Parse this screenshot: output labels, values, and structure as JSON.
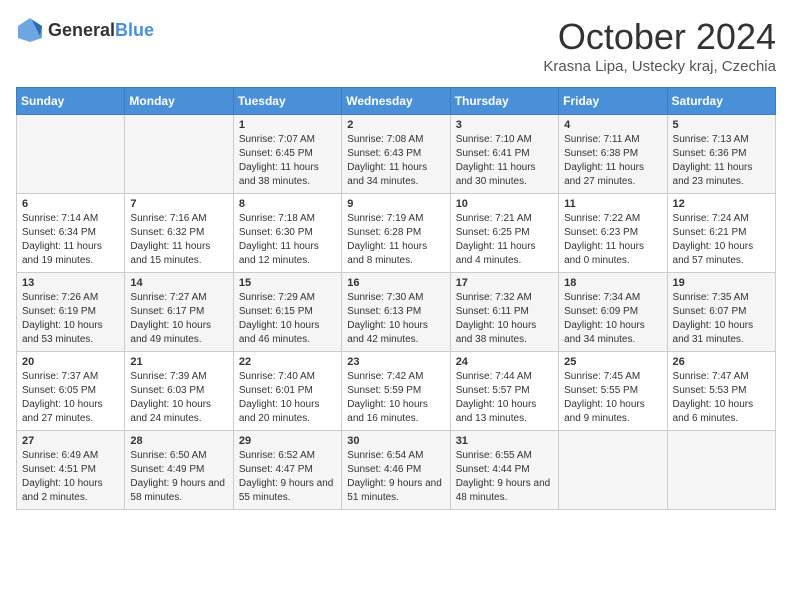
{
  "header": {
    "logo_general": "General",
    "logo_blue": "Blue",
    "month_year": "October 2024",
    "location": "Krasna Lipa, Ustecky kraj, Czechia"
  },
  "days_of_week": [
    "Sunday",
    "Monday",
    "Tuesday",
    "Wednesday",
    "Thursday",
    "Friday",
    "Saturday"
  ],
  "weeks": [
    [
      {
        "day": "",
        "content": ""
      },
      {
        "day": "",
        "content": ""
      },
      {
        "day": "1",
        "content": "Sunrise: 7:07 AM\nSunset: 6:45 PM\nDaylight: 11 hours and 38 minutes."
      },
      {
        "day": "2",
        "content": "Sunrise: 7:08 AM\nSunset: 6:43 PM\nDaylight: 11 hours and 34 minutes."
      },
      {
        "day": "3",
        "content": "Sunrise: 7:10 AM\nSunset: 6:41 PM\nDaylight: 11 hours and 30 minutes."
      },
      {
        "day": "4",
        "content": "Sunrise: 7:11 AM\nSunset: 6:38 PM\nDaylight: 11 hours and 27 minutes."
      },
      {
        "day": "5",
        "content": "Sunrise: 7:13 AM\nSunset: 6:36 PM\nDaylight: 11 hours and 23 minutes."
      }
    ],
    [
      {
        "day": "6",
        "content": "Sunrise: 7:14 AM\nSunset: 6:34 PM\nDaylight: 11 hours and 19 minutes."
      },
      {
        "day": "7",
        "content": "Sunrise: 7:16 AM\nSunset: 6:32 PM\nDaylight: 11 hours and 15 minutes."
      },
      {
        "day": "8",
        "content": "Sunrise: 7:18 AM\nSunset: 6:30 PM\nDaylight: 11 hours and 12 minutes."
      },
      {
        "day": "9",
        "content": "Sunrise: 7:19 AM\nSunset: 6:28 PM\nDaylight: 11 hours and 8 minutes."
      },
      {
        "day": "10",
        "content": "Sunrise: 7:21 AM\nSunset: 6:25 PM\nDaylight: 11 hours and 4 minutes."
      },
      {
        "day": "11",
        "content": "Sunrise: 7:22 AM\nSunset: 6:23 PM\nDaylight: 11 hours and 0 minutes."
      },
      {
        "day": "12",
        "content": "Sunrise: 7:24 AM\nSunset: 6:21 PM\nDaylight: 10 hours and 57 minutes."
      }
    ],
    [
      {
        "day": "13",
        "content": "Sunrise: 7:26 AM\nSunset: 6:19 PM\nDaylight: 10 hours and 53 minutes."
      },
      {
        "day": "14",
        "content": "Sunrise: 7:27 AM\nSunset: 6:17 PM\nDaylight: 10 hours and 49 minutes."
      },
      {
        "day": "15",
        "content": "Sunrise: 7:29 AM\nSunset: 6:15 PM\nDaylight: 10 hours and 46 minutes."
      },
      {
        "day": "16",
        "content": "Sunrise: 7:30 AM\nSunset: 6:13 PM\nDaylight: 10 hours and 42 minutes."
      },
      {
        "day": "17",
        "content": "Sunrise: 7:32 AM\nSunset: 6:11 PM\nDaylight: 10 hours and 38 minutes."
      },
      {
        "day": "18",
        "content": "Sunrise: 7:34 AM\nSunset: 6:09 PM\nDaylight: 10 hours and 34 minutes."
      },
      {
        "day": "19",
        "content": "Sunrise: 7:35 AM\nSunset: 6:07 PM\nDaylight: 10 hours and 31 minutes."
      }
    ],
    [
      {
        "day": "20",
        "content": "Sunrise: 7:37 AM\nSunset: 6:05 PM\nDaylight: 10 hours and 27 minutes."
      },
      {
        "day": "21",
        "content": "Sunrise: 7:39 AM\nSunset: 6:03 PM\nDaylight: 10 hours and 24 minutes."
      },
      {
        "day": "22",
        "content": "Sunrise: 7:40 AM\nSunset: 6:01 PM\nDaylight: 10 hours and 20 minutes."
      },
      {
        "day": "23",
        "content": "Sunrise: 7:42 AM\nSunset: 5:59 PM\nDaylight: 10 hours and 16 minutes."
      },
      {
        "day": "24",
        "content": "Sunrise: 7:44 AM\nSunset: 5:57 PM\nDaylight: 10 hours and 13 minutes."
      },
      {
        "day": "25",
        "content": "Sunrise: 7:45 AM\nSunset: 5:55 PM\nDaylight: 10 hours and 9 minutes."
      },
      {
        "day": "26",
        "content": "Sunrise: 7:47 AM\nSunset: 5:53 PM\nDaylight: 10 hours and 6 minutes."
      }
    ],
    [
      {
        "day": "27",
        "content": "Sunrise: 6:49 AM\nSunset: 4:51 PM\nDaylight: 10 hours and 2 minutes."
      },
      {
        "day": "28",
        "content": "Sunrise: 6:50 AM\nSunset: 4:49 PM\nDaylight: 9 hours and 58 minutes."
      },
      {
        "day": "29",
        "content": "Sunrise: 6:52 AM\nSunset: 4:47 PM\nDaylight: 9 hours and 55 minutes."
      },
      {
        "day": "30",
        "content": "Sunrise: 6:54 AM\nSunset: 4:46 PM\nDaylight: 9 hours and 51 minutes."
      },
      {
        "day": "31",
        "content": "Sunrise: 6:55 AM\nSunset: 4:44 PM\nDaylight: 9 hours and 48 minutes."
      },
      {
        "day": "",
        "content": ""
      },
      {
        "day": "",
        "content": ""
      }
    ]
  ]
}
